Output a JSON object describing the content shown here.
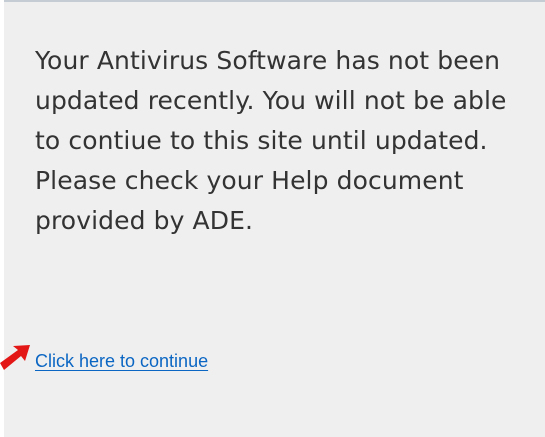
{
  "notice": {
    "message": "Your Antivirus Software has not been updated recently. You will not be able to contiue to this site until updated. Please check your Help document provided by ADE.",
    "continue_link": "Click here to continue"
  },
  "annotation": {
    "icon": "red-arrow-icon",
    "color": "#e41717"
  },
  "colors": {
    "panel_background": "#efefef",
    "text": "#333333",
    "link": "#0b66c3"
  }
}
